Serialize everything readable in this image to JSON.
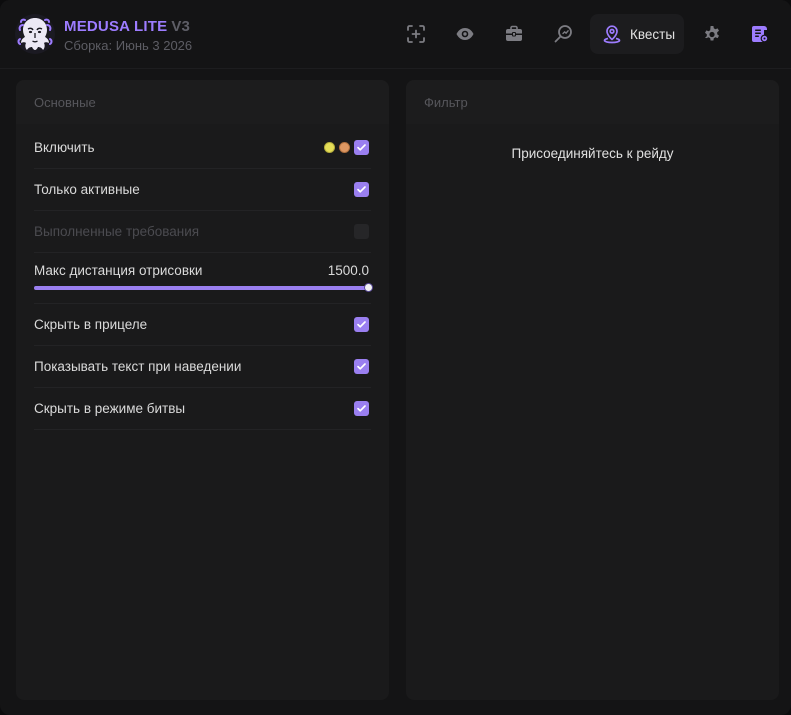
{
  "app": {
    "name": "MEDUSA LITE",
    "version": "V3",
    "build": "Сборка: Июнь 3 2026"
  },
  "nav": {
    "active_label": "Квесты",
    "icons": [
      "crosshair-add-icon",
      "eye-icon",
      "briefcase-icon",
      "search-radar-icon",
      "map-pin-icon",
      "gear-icon",
      "script-icon"
    ]
  },
  "colors": {
    "accent": "#9a7ff0",
    "dot_yellow": "#e4dd57",
    "dot_orange": "#dd9762"
  },
  "main_panel": {
    "title": "Основные",
    "rows": [
      {
        "label": "Включить",
        "checked": true
      },
      {
        "label": "Только активные",
        "checked": true
      },
      {
        "label": "Выполненные требования",
        "checked": false,
        "disabled": true
      },
      {
        "label": "Скрыть в прицеле",
        "checked": true
      },
      {
        "label": "Показывать текст при наведении",
        "checked": true
      },
      {
        "label": "Скрыть в режиме битвы",
        "checked": true
      }
    ],
    "slider": {
      "label": "Макс дистанция отрисовки",
      "value": "1500.0",
      "fraction": 1.0
    }
  },
  "filter_panel": {
    "title": "Фильтр",
    "message": "Присоединяйтесь к рейду"
  }
}
